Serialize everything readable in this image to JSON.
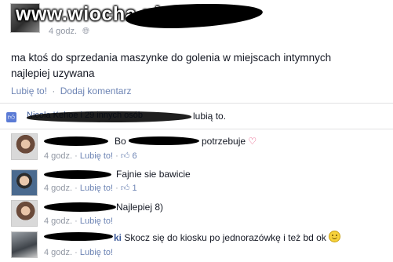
{
  "watermark": "www.wiocha.pl",
  "post": {
    "time": "4 godz.",
    "time_icon": "globe-icon",
    "text_line1": "ma ktoś do sprzedania maszynke do golenia w miejscach intymnych",
    "text_line2": "najlepiej uzywana",
    "like_label": "Lubię to!",
    "comment_label": "Dodaj komentarz",
    "separator": "·"
  },
  "likes": {
    "names": "Nicola Kehoe i 29 innych osób",
    "suffix": "lubią to.",
    "icon": "thumb-up-icon"
  },
  "comments": [
    {
      "text_before": "Bo",
      "text_after": "potrzebuje",
      "emoji": "heart-icon",
      "time": "4 godz.",
      "like_label": "Lubię to!",
      "like_count": "6"
    },
    {
      "text": "Fajnie sie bawicie",
      "time": "4 godz.",
      "like_label": "Lubię to!",
      "like_count": "1"
    },
    {
      "text": "Najlepiej 8)",
      "time": "4 godz.",
      "like_label": "Lubię to!"
    },
    {
      "name_tail": "ki",
      "text": "Skocz się do kiosku po jednorazówkę i też bd ok",
      "emoji": "smiley-icon",
      "time": "4 godz.",
      "like_label": "Lubię to!"
    }
  ],
  "colors": {
    "link": "#6d84b4",
    "meta": "#9197a3",
    "text": "#141823",
    "name": "#3b5998"
  }
}
